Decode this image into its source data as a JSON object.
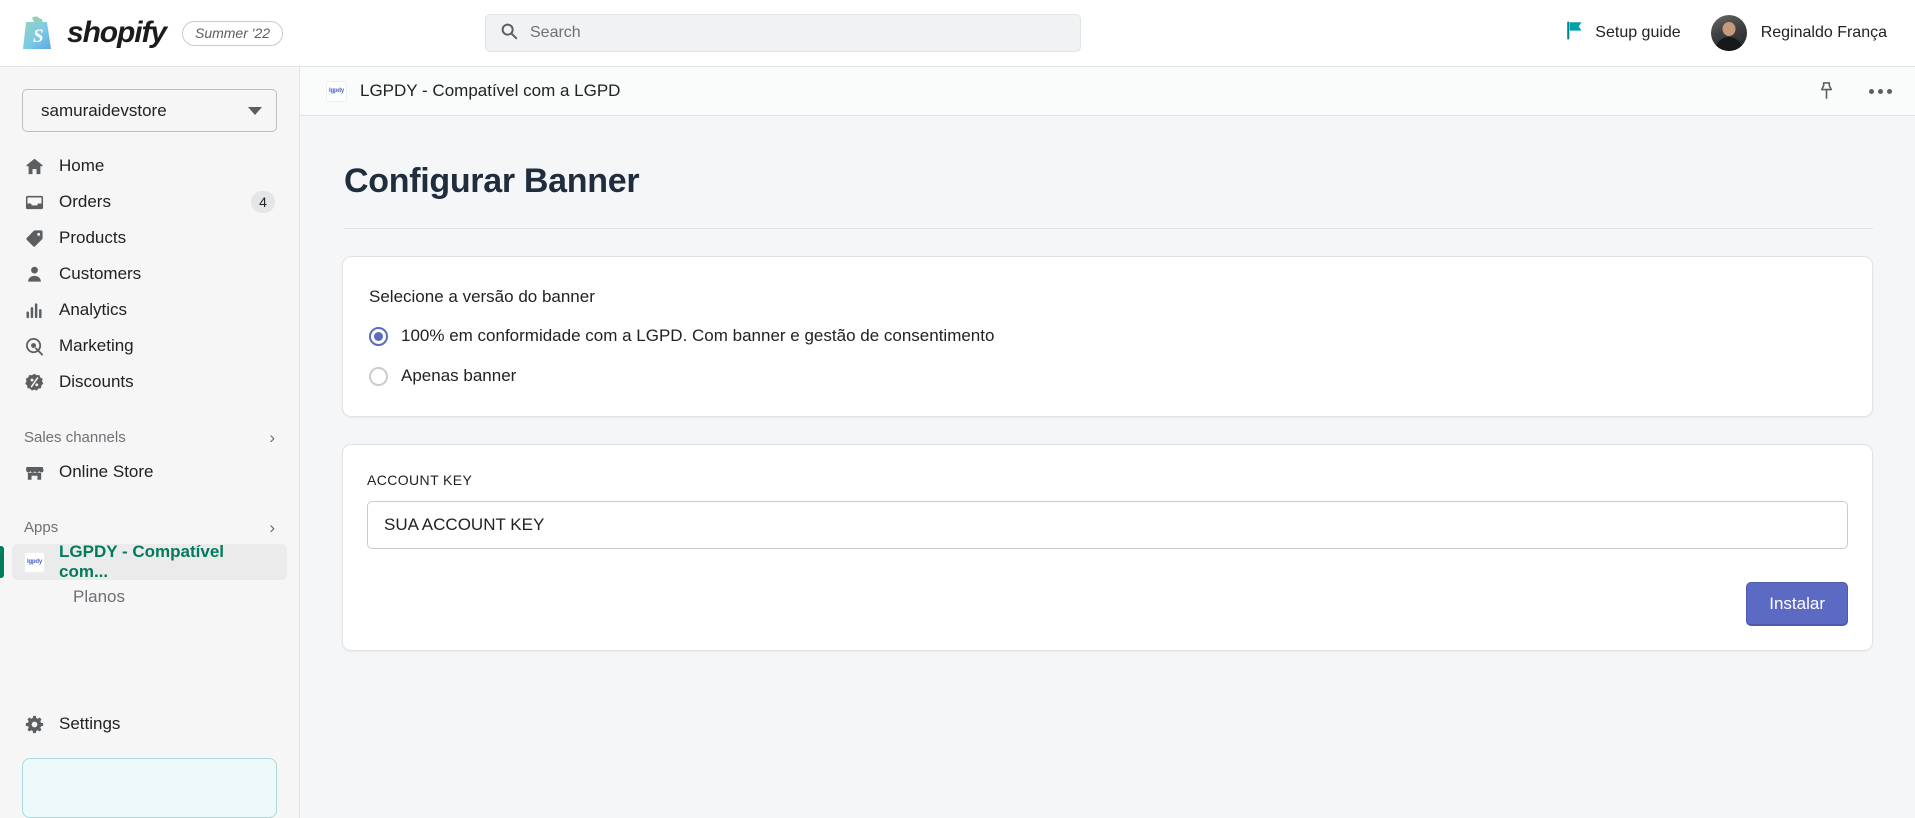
{
  "topbar": {
    "brand_word": "shopify",
    "season_badge": "Summer '22",
    "search_placeholder": "Search",
    "setup_guide_label": "Setup guide",
    "user_name": "Reginaldo França",
    "flag_color": "#00848e"
  },
  "sidebar": {
    "store_name": "samuraidevstore",
    "items": [
      {
        "label": "Home",
        "icon": "home-icon",
        "badge": ""
      },
      {
        "label": "Orders",
        "icon": "orders-icon",
        "badge": "4"
      },
      {
        "label": "Products",
        "icon": "products-tag-icon",
        "badge": ""
      },
      {
        "label": "Customers",
        "icon": "customers-person-icon",
        "badge": ""
      },
      {
        "label": "Analytics",
        "icon": "analytics-bars-icon",
        "badge": ""
      },
      {
        "label": "Marketing",
        "icon": "marketing-target-icon",
        "badge": ""
      },
      {
        "label": "Discounts",
        "icon": "discounts-percent-icon",
        "badge": ""
      }
    ],
    "sales_channels": {
      "title": "Sales channels",
      "items": [
        {
          "label": "Online Store",
          "icon": "online-store-icon"
        }
      ]
    },
    "apps": {
      "title": "Apps",
      "active_app": "LGPDY - Compatível com...",
      "app_icon_text": "lgpdy",
      "sub_items": [
        "Planos"
      ]
    },
    "settings_label": "Settings",
    "active_color": "#007b5c"
  },
  "appbar": {
    "title": "LGPDY - Compatível com a LGPD",
    "app_icon_text": "lgpdy",
    "pin_label": "pin-icon",
    "more_label": "more-actions-icon"
  },
  "page": {
    "title": "Configurar Banner"
  },
  "version_card": {
    "label": "Selecione a versão do banner",
    "options": [
      {
        "label": "100% em conformidade com a LGPD. Com banner e gestão de consentimento",
        "checked": true
      },
      {
        "label": "Apenas banner",
        "checked": false
      }
    ],
    "accent_color": "#5c6ac4"
  },
  "account_card": {
    "label": "ACCOUNT KEY",
    "input_value": "SUA ACCOUNT KEY",
    "input_placeholder": "SUA ACCOUNT KEY",
    "button_label": "Instalar",
    "button_color": "#5c6ac4"
  }
}
